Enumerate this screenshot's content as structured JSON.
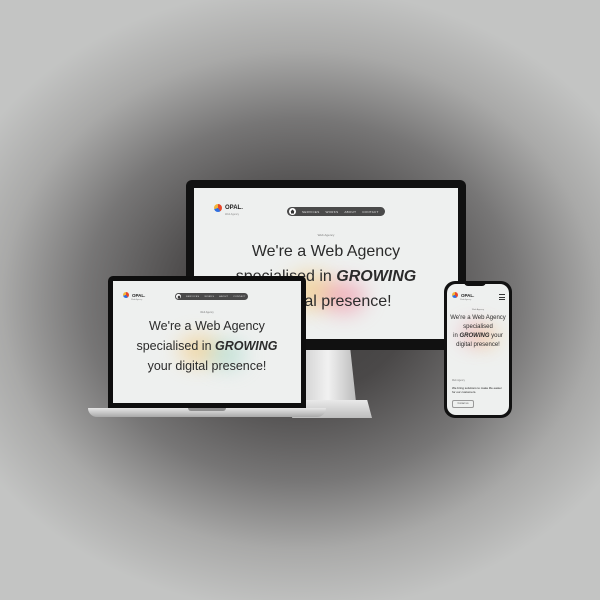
{
  "site": {
    "brand": "OPAL.",
    "brand_sub": "Web Agency",
    "nav": [
      "Services",
      "Works",
      "About",
      "Contact"
    ],
    "eyebrow": "Web Agency",
    "headline_line1": "We're a Web Agency",
    "headline_line2_pre": "specialised in ",
    "headline_line2_em": "GROWING",
    "headline_line3": "your digital presence!",
    "imac_line3_visible": "ital presence!"
  },
  "phone": {
    "headline_line1": "We're a Web Agency",
    "headline_line2": "specialised",
    "headline_line2b_pre": "in ",
    "headline_line2b_em": "GROWING",
    "headline_line2b_post": " your",
    "headline_line3": "digital presence!",
    "section_label": "Web Agency",
    "body": "We bring solutions to make life easier for our customers.",
    "button": "Contact us"
  },
  "colors": {
    "screen_bg": "#eef0ef",
    "nav_bg": "#4a4a4a",
    "text_dark": "#2b2b2b",
    "logo_red": "#e8472a",
    "logo_blue": "#2f6fe0",
    "logo_yellow": "#f2b53a"
  },
  "icons": [
    "logo-icon",
    "home-icon",
    "menu-icon"
  ]
}
